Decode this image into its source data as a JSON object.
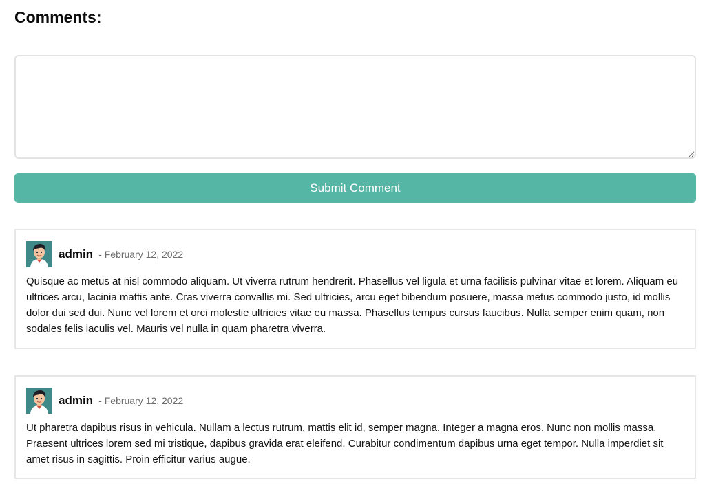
{
  "section": {
    "title": "Comments:"
  },
  "form": {
    "textarea_value": "",
    "textarea_placeholder": "",
    "submit_label": "Submit Comment",
    "submit_color": "#55b6a5"
  },
  "comments": [
    {
      "author": "admin",
      "separator": "-",
      "date": "February 12, 2022",
      "avatar_icon": "user-avatar-icon",
      "text": "Quisque ac metus at nisl commodo aliquam. Ut viverra rutrum hendrerit. Phasellus vel ligula et urna facilisis pulvinar vitae et lorem. Aliquam eu ultrices arcu, lacinia mattis ante. Cras viverra convallis mi. Sed ultricies, arcu eget bibendum posuere, massa metus commodo justo, id mollis dolor dui sed dui. Nunc vel lorem et orci molestie ultricies vitae eu massa. Phasellus tempus cursus faucibus. Nulla semper enim quam, non sodales felis iaculis vel. Mauris vel nulla in quam pharetra viverra."
    },
    {
      "author": "admin",
      "separator": "-",
      "date": "February 12, 2022",
      "avatar_icon": "user-avatar-icon",
      "text": "Ut pharetra dapibus risus in vehicula. Nullam a lectus rutrum, mattis elit id, semper magna. Integer a magna eros. Nunc non mollis massa. Praesent ultrices lorem sed mi tristique, dapibus gravida erat eleifend. Curabitur condimentum dapibus urna eget tempor. Nulla imperdiet sit amet risus in sagittis. Proin efficitur varius augue."
    }
  ]
}
